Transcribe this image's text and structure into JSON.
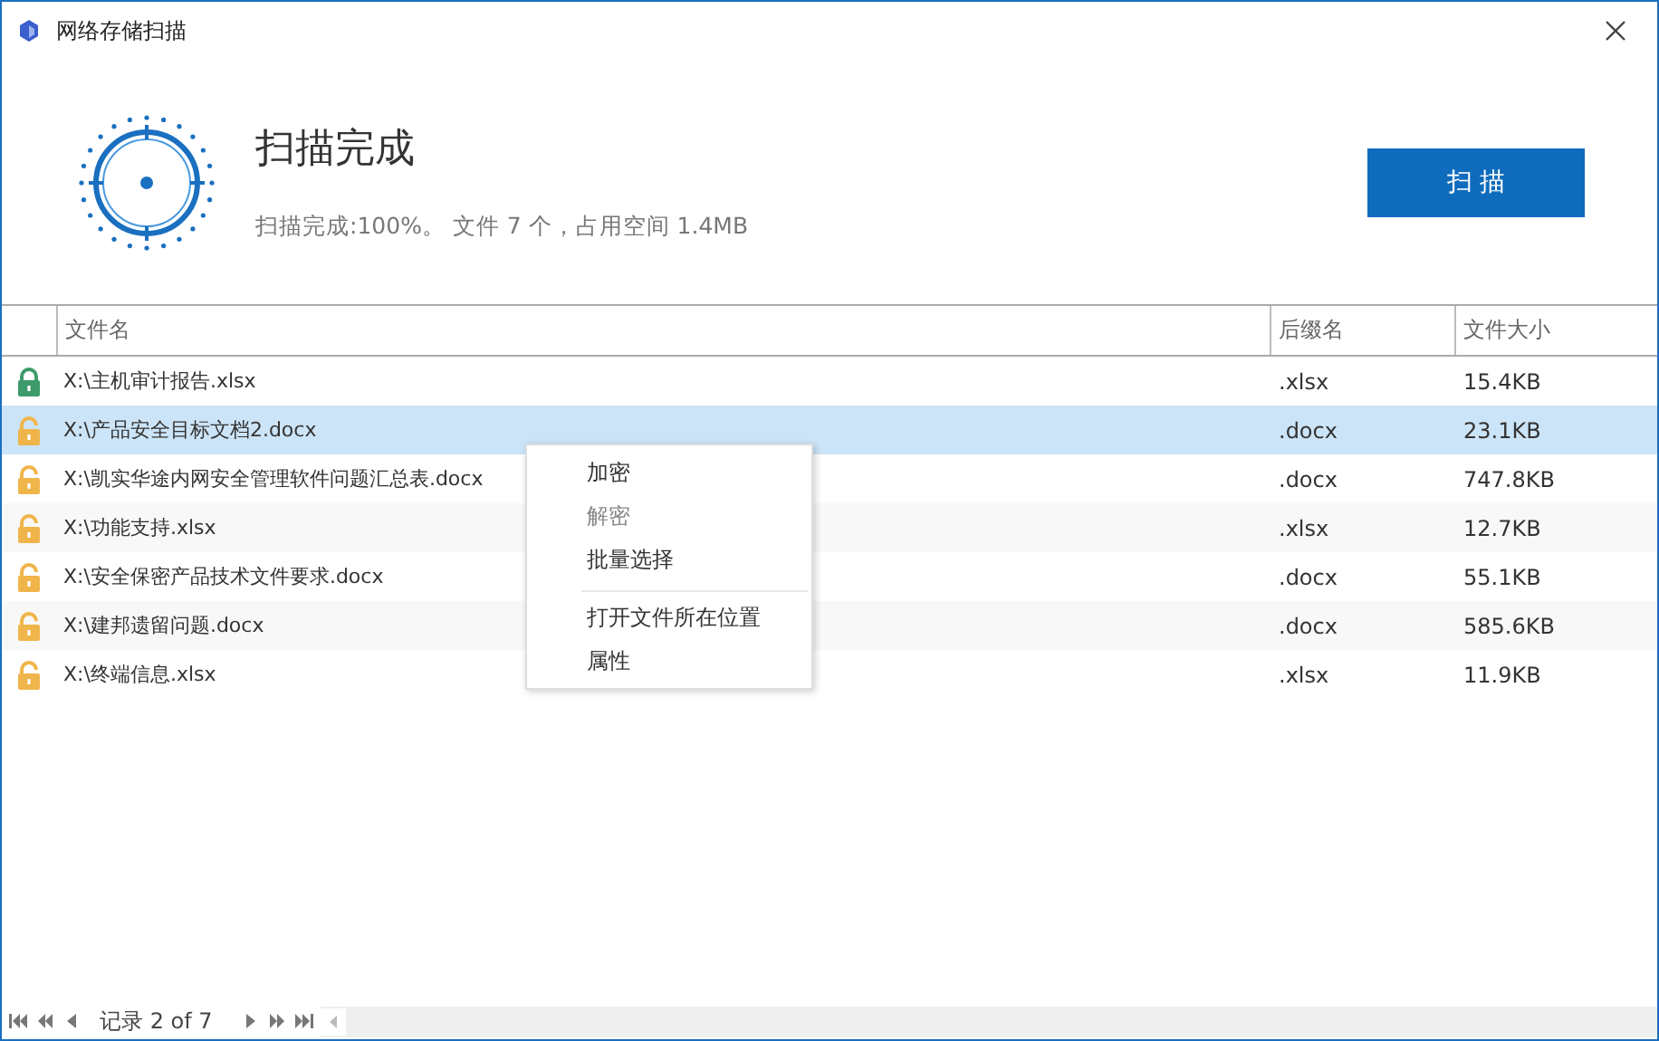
{
  "window": {
    "title": "网络存储扫描"
  },
  "status": {
    "title": "扫描完成",
    "summary": "扫描完成:100%。 文件 7 个，占用空间 1.4MB"
  },
  "scan_button": "扫 描",
  "table": {
    "columns": [
      "文件名",
      "后缀名",
      "文件大小"
    ],
    "rows": [
      {
        "name": "X:\\主机审计报告.xlsx",
        "ext": ".xlsx",
        "size": "15.4KB",
        "locked": true,
        "selected": false
      },
      {
        "name": "X:\\产品安全目标文档2.docx",
        "ext": ".docx",
        "size": "23.1KB",
        "locked": false,
        "selected": true
      },
      {
        "name": "X:\\凯实华途内网安全管理软件问题汇总表.docx",
        "ext": ".docx",
        "size": "747.8KB",
        "locked": false,
        "selected": false
      },
      {
        "name": "X:\\功能支持.xlsx",
        "ext": ".xlsx",
        "size": "12.7KB",
        "locked": false,
        "selected": false
      },
      {
        "name": "X:\\安全保密产品技术文件要求.docx",
        "ext": ".docx",
        "size": "55.1KB",
        "locked": false,
        "selected": false
      },
      {
        "name": "X:\\建邦遗留问题.docx",
        "ext": ".docx",
        "size": "585.6KB",
        "locked": false,
        "selected": false
      },
      {
        "name": "X:\\终端信息.xlsx",
        "ext": ".xlsx",
        "size": "11.9KB",
        "locked": false,
        "selected": false
      }
    ]
  },
  "context_menu": [
    {
      "kind": "item",
      "label": "加密",
      "disabled": false
    },
    {
      "kind": "item",
      "label": "解密",
      "disabled": true
    },
    {
      "kind": "item",
      "label": "批量选择",
      "disabled": false
    },
    {
      "kind": "separator"
    },
    {
      "kind": "item",
      "label": "打开文件所在位置",
      "disabled": false
    },
    {
      "kind": "item",
      "label": "属性",
      "disabled": false
    }
  ],
  "pager": {
    "label": "记录 2 of 7"
  }
}
